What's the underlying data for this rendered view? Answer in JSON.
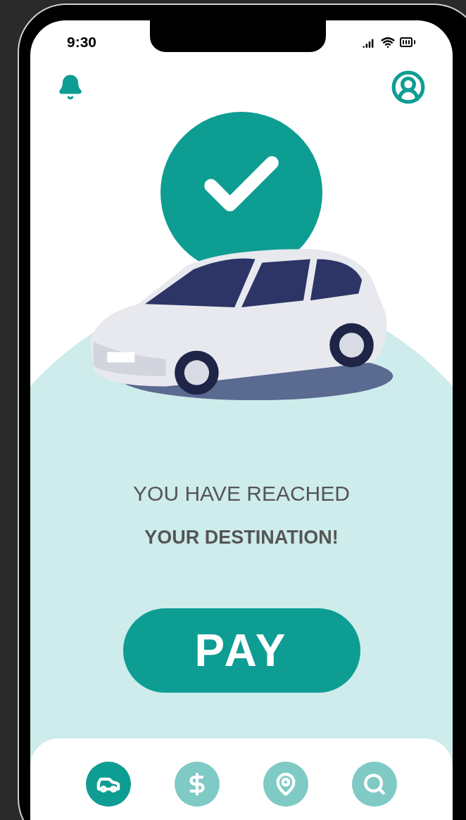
{
  "status_bar": {
    "time": "9:30"
  },
  "message": {
    "line_1": "YOU HAVE REACHED",
    "line_2": "YOUR DESTINATION!"
  },
  "pay_button": {
    "label": "PAY"
  },
  "bottom_nav": [
    {
      "kind": "car",
      "selected": true
    },
    {
      "kind": "dollar",
      "selected": false
    },
    {
      "kind": "location",
      "selected": false
    },
    {
      "kind": "search",
      "selected": false
    }
  ]
}
